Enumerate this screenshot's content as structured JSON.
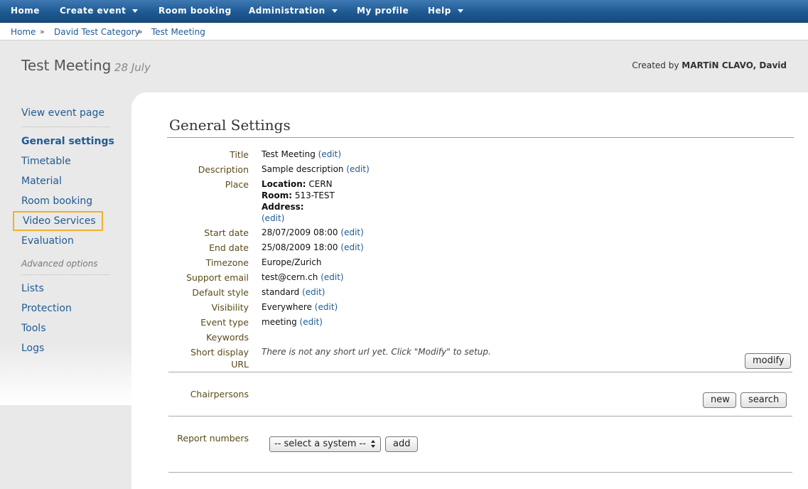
{
  "nav": {
    "items": [
      {
        "label": "Home",
        "has_menu": false
      },
      {
        "label": "Create event",
        "has_menu": true
      },
      {
        "label": "Room booking",
        "has_menu": false
      },
      {
        "label": "Administration",
        "has_menu": true
      },
      {
        "label": "My profile",
        "has_menu": false
      },
      {
        "label": "Help",
        "has_menu": true
      }
    ]
  },
  "breadcrumb": {
    "items": [
      "Home",
      "David Test Category",
      "Test Meeting"
    ],
    "separator": "»"
  },
  "header": {
    "title": "Test Meeting",
    "date": "28 July",
    "created_by_prefix": "Created by",
    "created_by_name": "MARTiN CLAVO, David"
  },
  "sidebar": {
    "view_event": "View event page",
    "items": [
      {
        "label": "General settings",
        "active": true
      },
      {
        "label": "Timetable"
      },
      {
        "label": "Material"
      },
      {
        "label": "Room booking"
      },
      {
        "label": "Video Services",
        "highlighted": true
      },
      {
        "label": "Evaluation"
      }
    ],
    "advanced_label": "Advanced options",
    "advanced_items": [
      {
        "label": "Lists"
      },
      {
        "label": "Protection"
      },
      {
        "label": "Tools"
      },
      {
        "label": "Logs"
      }
    ]
  },
  "main": {
    "section_title": "General Settings",
    "edit_label": "(edit)",
    "fields": {
      "title": {
        "label": "Title",
        "value": "Test Meeting"
      },
      "description": {
        "label": "Description",
        "value": "Sample description"
      },
      "place": {
        "label": "Place",
        "location_label": "Location:",
        "location": "CERN",
        "room_label": "Room:",
        "room": "513-TEST",
        "address_label": "Address:"
      },
      "start_date": {
        "label": "Start date",
        "value": "28/07/2009 08:00"
      },
      "end_date": {
        "label": "End date",
        "value": "25/08/2009 18:00"
      },
      "timezone": {
        "label": "Timezone",
        "value": "Europe/Zurich"
      },
      "support_email": {
        "label": "Support email",
        "value": "test@cern.ch"
      },
      "default_style": {
        "label": "Default style",
        "value": "standard"
      },
      "visibility": {
        "label": "Visibility",
        "value": "Everywhere"
      },
      "event_type": {
        "label": "Event type",
        "value": "meeting"
      },
      "keywords": {
        "label": "Keywords",
        "value": ""
      },
      "short_url": {
        "label_line1": "Short display",
        "label_line2": "URL",
        "value": "There is not any short url yet. Click \"Modify\" to setup."
      }
    },
    "modify_button": "modify",
    "chairpersons": {
      "label": "Chairpersons",
      "new_button": "new",
      "search_button": "search"
    },
    "report_numbers": {
      "label": "Report numbers",
      "select_value": "-- select a system --",
      "add_button": "add"
    }
  },
  "colors": {
    "nav_bg": "#1f5a93",
    "link": "#1f5a93",
    "label": "#5a4a1a",
    "highlight": "#f0b030"
  }
}
